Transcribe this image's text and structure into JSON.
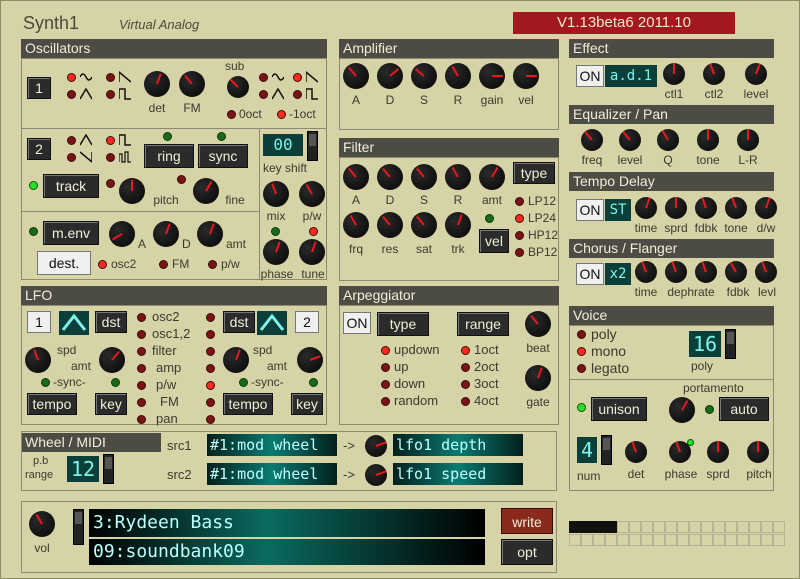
{
  "header": {
    "title": "Synth1",
    "subtitle": "Virtual Analog",
    "version": "V1.13beta6 2011.10"
  },
  "osc": {
    "title": "Oscillators",
    "n1": "1",
    "n2": "2",
    "det": "det",
    "fm": "FM",
    "sub": "sub",
    "oct0": "0oct",
    "octm1": "-1oct",
    "ring": "ring",
    "sync": "sync",
    "track": "track",
    "pitch": "pitch",
    "fine": "fine",
    "keyshift_val": "00",
    "keyshift": "key shift",
    "mix": "mix",
    "pw": "p/w",
    "menv": "m.env",
    "a": "A",
    "d": "D",
    "amt": "amt",
    "dest": "dest.",
    "osc2": "osc2",
    "fmd": "FM",
    "pwd": "p/w",
    "phase": "phase",
    "tune": "tune"
  },
  "amp": {
    "title": "Amplifier",
    "a": "A",
    "d": "D",
    "s": "S",
    "r": "R",
    "gain": "gain",
    "vel": "vel"
  },
  "filter": {
    "title": "Filter",
    "type": "type",
    "a": "A",
    "d": "D",
    "s": "S",
    "r": "R",
    "amt": "amt",
    "frq": "frq",
    "res": "res",
    "sat": "sat",
    "trk": "trk",
    "vel": "vel",
    "types": [
      "LP12",
      "LP24",
      "HP12",
      "BP12"
    ]
  },
  "effect": {
    "title": "Effect",
    "on": "ON",
    "name": "a.d.1",
    "ctl1": "ctl1",
    "ctl2": "ctl2",
    "level": "level"
  },
  "eq": {
    "title": "Equalizer / Pan",
    "freq": "freq",
    "level": "level",
    "q": "Q",
    "tone": "tone",
    "lr": "L-R"
  },
  "delay": {
    "title": "Tempo Delay",
    "on": "ON",
    "mode": "ST",
    "time": "time",
    "sprd": "sprd",
    "fdbk": "fdbk",
    "tone": "tone",
    "dw": "d/w"
  },
  "chorus": {
    "title": "Chorus / Flanger",
    "on": "ON",
    "mode": "x2",
    "time": "time",
    "deph": "dephrate",
    "fdbk": "fdbk",
    "levl": "levl"
  },
  "lfo": {
    "title": "LFO",
    "n1": "1",
    "n2": "2",
    "dst": "dst",
    "spd": "spd",
    "amt": "amt",
    "sync": "-sync-",
    "tempo": "tempo",
    "key": "key",
    "dests": [
      "osc2",
      "osc1,2",
      "filter",
      "amp",
      "p/w",
      "FM",
      "pan"
    ]
  },
  "arp": {
    "title": "Arpeggiator",
    "on": "ON",
    "type": "type",
    "range": "range",
    "beat": "beat",
    "gate": "gate",
    "types": [
      "updown",
      "up",
      "down",
      "random"
    ],
    "ranges": [
      "1oct",
      "2oct",
      "3oct",
      "4oct"
    ]
  },
  "voice": {
    "title": "Voice",
    "modes": [
      "poly",
      "mono",
      "legato"
    ],
    "poly_val": "16",
    "poly": "poly",
    "portamento": "portamento",
    "unison": "unison",
    "auto": "auto",
    "num_val": "4",
    "num": "num",
    "det": "det",
    "phase": "phase",
    "sprd": "sprd",
    "pitch": "pitch"
  },
  "wheel": {
    "title": "Wheel / MIDI",
    "pb": "p.b",
    "range": "range",
    "pb_val": "12",
    "src1": "src1",
    "src2": "src2",
    "src1_val": "#1:mod wheel",
    "src2_val": "#1:mod wheel",
    "arrow": "->",
    "dst1": "lfo1 depth",
    "dst2": "lfo1 speed"
  },
  "footer": {
    "vol": "vol",
    "patch": "3:Rydeen Bass",
    "bank": "09:soundbank09",
    "write": "write",
    "opt": "opt"
  }
}
